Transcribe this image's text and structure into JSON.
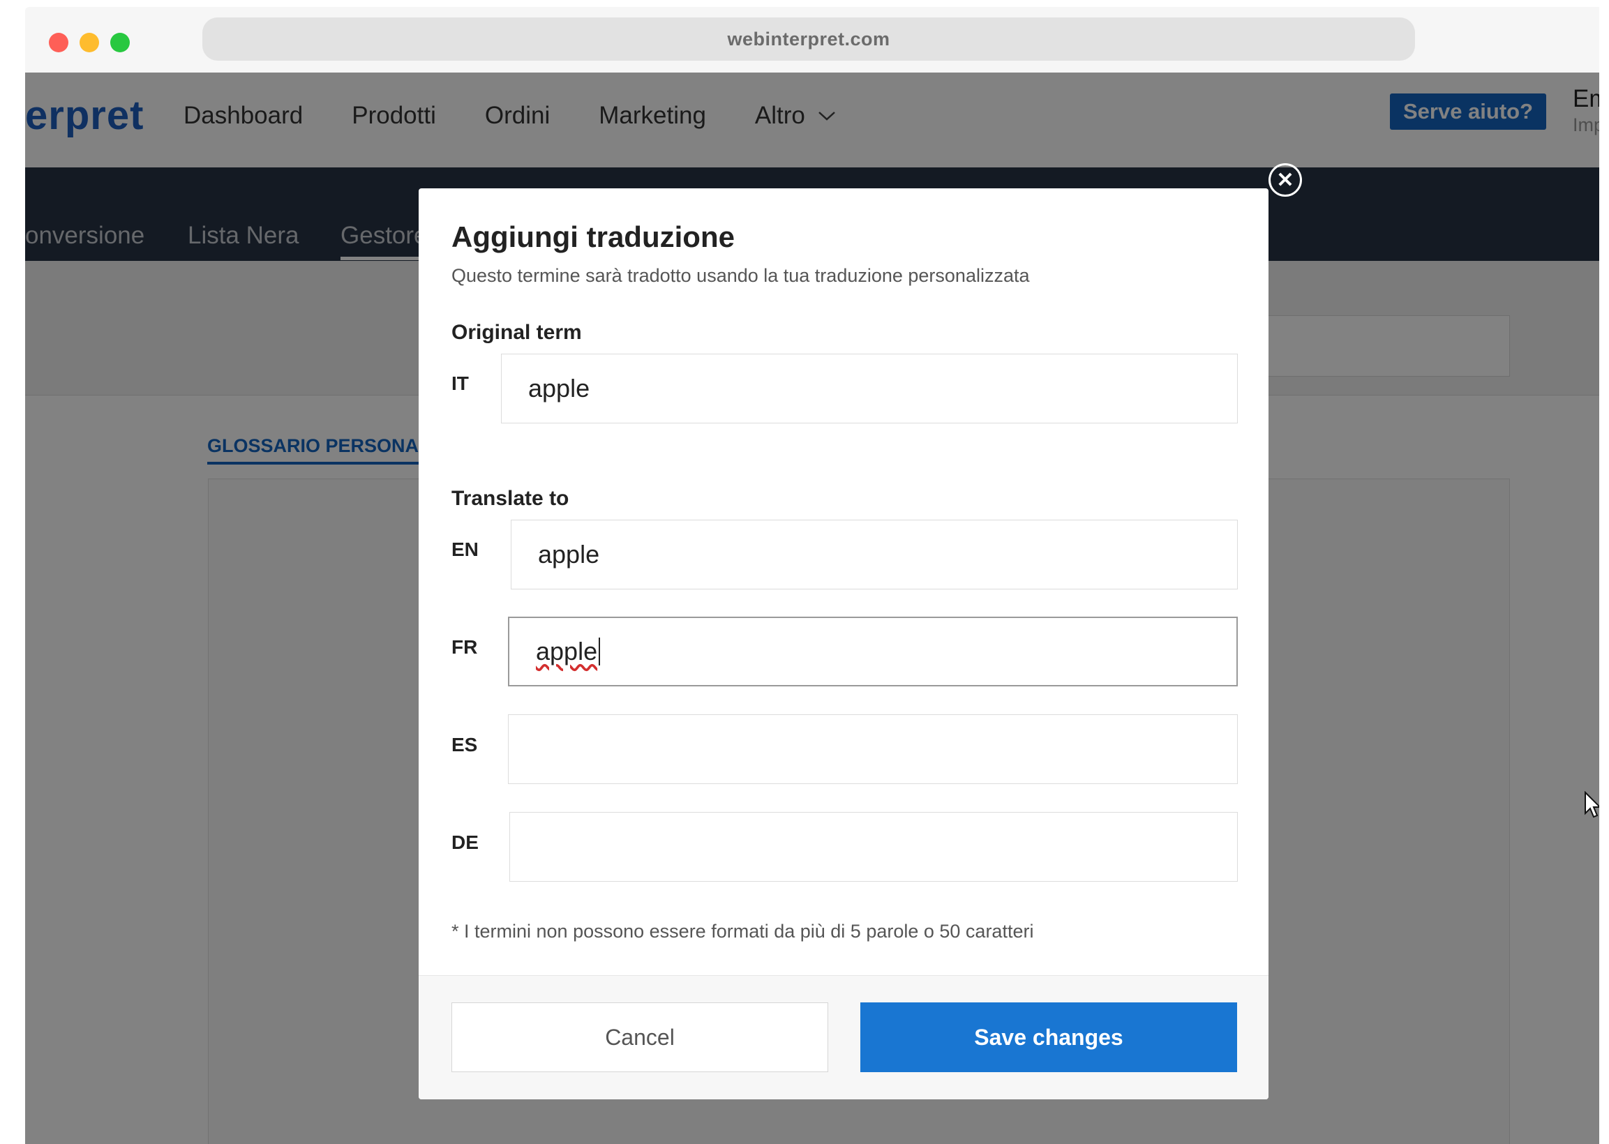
{
  "browser": {
    "url": "webinterpret.com"
  },
  "header": {
    "logo_text": "erpret",
    "nav": [
      "Dashboard",
      "Prodotti",
      "Ordini",
      "Marketing",
      "Altro"
    ],
    "help_button": "Serve aiuto?",
    "user_name": "Em",
    "user_sub": "Imp"
  },
  "subnav": {
    "items": [
      "onversione",
      "Lista Nera",
      "Gestore"
    ]
  },
  "main": {
    "glossary_tab": "GLOSSARIO PERSONALIZZA"
  },
  "modal": {
    "title": "Aggiungi traduzione",
    "subtitle": "Questo termine sarà tradotto usando la tua traduzione personalizzata",
    "original_label": "Original term",
    "original": {
      "lang": "IT",
      "value": "apple"
    },
    "translate_label": "Translate to",
    "translations": [
      {
        "lang": "EN",
        "value": "apple"
      },
      {
        "lang": "FR",
        "value": "apple"
      },
      {
        "lang": "ES",
        "value": ""
      },
      {
        "lang": "DE",
        "value": ""
      }
    ],
    "note": "* I termini non possono essere formati da più di 5 parole o 50 caratteri",
    "cancel_label": "Cancel",
    "save_label": "Save changes"
  },
  "colors": {
    "primary": "#1976d2",
    "subnav_bg": "#283346",
    "logo": "#1e5fbf"
  }
}
